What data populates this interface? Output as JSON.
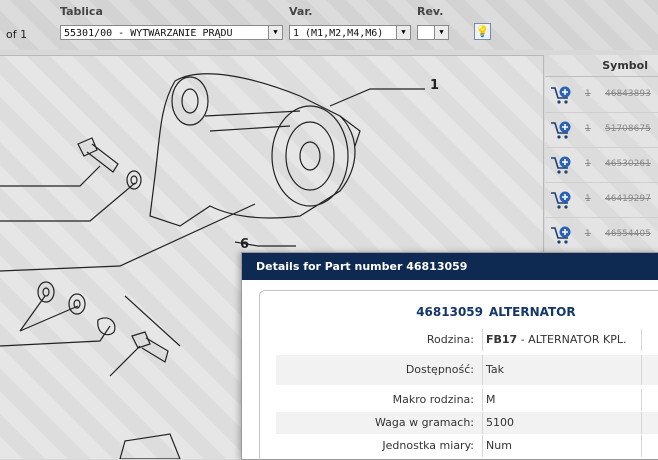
{
  "toolbar": {
    "page_info": "of 1",
    "tablica_label": "Tablica",
    "tablica_value": "55301/00 - WYTWARZANIE PRĄDU",
    "var_label": "Var.",
    "var_value": "1 (M1,M2,M4,M6)",
    "rev_label": "Rev.",
    "rev_value": ""
  },
  "diagram": {
    "callouts": [
      "1",
      "6"
    ]
  },
  "parts_list": {
    "header": "Symbol",
    "rows": [
      {
        "qty": "1",
        "part": "46843893"
      },
      {
        "qty": "1",
        "part": "51708675"
      },
      {
        "qty": "1",
        "part": "46530261"
      },
      {
        "qty": "1",
        "part": "46419297"
      },
      {
        "qty": "1",
        "part": "46554405"
      }
    ]
  },
  "details": {
    "title": "Details for Part number 46813059",
    "part_number": "46813059",
    "part_name": "ALTERNATOR",
    "fields": [
      {
        "key": "Rodzina:",
        "value_bold": "FB17",
        "value": " - ALTERNATOR KPL."
      },
      {
        "key": "Dostępność:",
        "value_bold": "",
        "value": "Tak"
      },
      {
        "key": "Makro rodzina:",
        "value_bold": "",
        "value": "M"
      },
      {
        "key": "Waga w gramach:",
        "value_bold": "",
        "value": "5100"
      },
      {
        "key": "Jednostka miary:",
        "value_bold": "",
        "value": "Num"
      }
    ]
  },
  "colors": {
    "popup_title_bg": "#0f2a52",
    "accent_text": "#13366b"
  }
}
